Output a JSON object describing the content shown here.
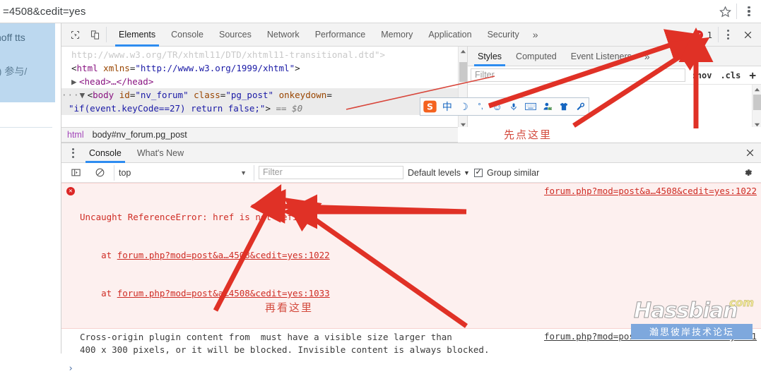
{
  "browser": {
    "url_fragment": "=4508&cedit=yes",
    "star_icon": "star-icon",
    "menu_icon": "kebab-menu-icon"
  },
  "page_behind": {
    "text_fragment_1": "noff  tts",
    "text_fragment_2": ". )  参与/"
  },
  "devtools": {
    "inspect_icon": "inspect-element-icon",
    "device_icon": "device-toolbar-icon",
    "tabs": [
      {
        "label": "Elements",
        "active": true
      },
      {
        "label": "Console",
        "active": false
      },
      {
        "label": "Sources",
        "active": false
      },
      {
        "label": "Network",
        "active": false
      },
      {
        "label": "Performance",
        "active": false
      },
      {
        "label": "Memory",
        "active": false
      },
      {
        "label": "Application",
        "active": false
      },
      {
        "label": "Security",
        "active": false
      }
    ],
    "more_tabs": "»",
    "error_count": "1",
    "error_badge_glyph": "✕",
    "kebab_icon": "more-options-icon",
    "close_icon": "close-devtools-icon"
  },
  "dom_tree": {
    "lines": [
      {
        "type": "faded",
        "text": "http://www.w3.org/TR/xhtml11/DTD/xhtml11-transitional.dtd\">"
      },
      {
        "type": "html_open",
        "tag": "html",
        "attr": "xmlns",
        "value": "\"http://www.w3.org/1999/xhtml\""
      },
      {
        "type": "head",
        "text": "<head>…</head>"
      },
      {
        "type": "body_open",
        "tag": "body",
        "attrs": [
          {
            "name": "id",
            "value": "\"nv_forum\""
          },
          {
            "name": "class",
            "value": "\"pg_post\""
          },
          {
            "name": "onkeydown",
            "value": ""
          }
        ]
      },
      {
        "type": "body_cont",
        "text": "\"if(event.keyCode==27) return false;\"> == $0"
      }
    ],
    "scrollbar": "dom-tree-scrollbar"
  },
  "breadcrumb": {
    "items": [
      "html",
      "body#nv_forum.pg_post"
    ]
  },
  "styles_pane": {
    "tabs": [
      {
        "label": "Styles",
        "active": true
      },
      {
        "label": "Computed",
        "active": false
      },
      {
        "label": "Event Listeners",
        "active": false
      }
    ],
    "more_tabs": "»",
    "filter_placeholder": "Filter",
    "hov_label": ":hov",
    "cls_label": ".cls",
    "add_rule_label": "+",
    "body_text": "}"
  },
  "drawer": {
    "kebab_icon": "drawer-more-options-icon",
    "tabs": [
      {
        "label": "Console",
        "active": true
      },
      {
        "label": "What's New",
        "active": false
      }
    ],
    "close_icon": "close-drawer-icon"
  },
  "console_toolbar": {
    "sidebar_toggle_icon": "console-sidebar-icon",
    "clear_icon": "clear-console-icon",
    "context": "top",
    "context_caret": "▼",
    "filter_placeholder": "Filter",
    "levels_label": "Default levels",
    "levels_caret": "▼",
    "group_similar_label": "Group similar",
    "group_similar_checked": true,
    "settings_icon": "console-settings-gear-icon"
  },
  "console_messages": [
    {
      "level": "error",
      "icon": "error-circle-icon",
      "text": "Uncaught ReferenceError: href is not defined",
      "stack": [
        {
          "prefix": "    at ",
          "link": "forum.php?mod=post&a…4508&cedit=yes:1022"
        },
        {
          "prefix": "    at ",
          "link": "forum.php?mod=post&a…4508&cedit=yes:1033"
        }
      ],
      "source": "forum.php?mod=post&a…4508&cedit=yes:1022"
    },
    {
      "level": "warn",
      "icon": "",
      "text": "Cross-origin plugin content from  must have a visible size larger than\n400 x 300 pixels, or it will be blocked. Invisible content is always blocked.",
      "stack": [],
      "source": "forum.php?mod=post&a…id=4508&cedit=yes:1"
    }
  ],
  "console_prompt": {
    "caret": "›"
  },
  "ime_toolbar": {
    "name": "sogou-ime-toolbar",
    "logo": "S",
    "items": [
      {
        "icon": "chinese-mode-icon",
        "glyph": "中"
      },
      {
        "icon": "moon-icon",
        "glyph": "☽"
      },
      {
        "icon": "punctuation-icon",
        "glyph": "°,"
      },
      {
        "icon": "emoji-icon",
        "glyph": "☺"
      },
      {
        "icon": "voice-input-icon",
        "glyph": "🎤"
      },
      {
        "icon": "soft-keyboard-icon",
        "glyph": "⌨"
      },
      {
        "icon": "user-center-icon",
        "glyph": "👤"
      },
      {
        "icon": "skin-icon",
        "glyph": "👕"
      },
      {
        "icon": "toolbox-icon",
        "glyph": "🔧"
      }
    ]
  },
  "annotations": [
    {
      "name": "annotation-click-here-first",
      "text": "先点这里"
    },
    {
      "name": "annotation-look-here-next",
      "text": "再看这里"
    }
  ],
  "watermark": {
    "brand": "Hassbian",
    "tld": "com",
    "subtitle": "瀚思彼岸技术论坛"
  },
  "colors": {
    "accent": "#2d8cf0",
    "error": "#dc2626",
    "error_bg": "#fdf0ef",
    "annotation": "#d34a3d",
    "tag": "#881280",
    "attr": "#994500",
    "value": "#1a1aa6"
  }
}
